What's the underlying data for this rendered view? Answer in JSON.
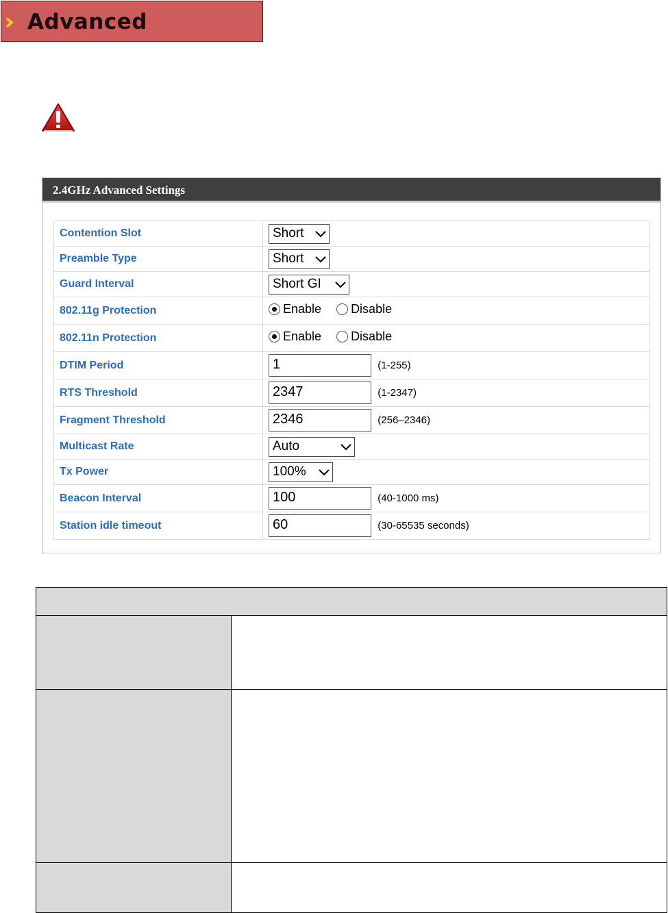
{
  "header": {
    "title": "Advanced"
  },
  "panel": {
    "title": "2.4GHz Advanced Settings",
    "rows": [
      {
        "label": "Contention Slot",
        "kind": "select",
        "value": "Short"
      },
      {
        "label": "Preamble Type",
        "kind": "select",
        "value": "Short"
      },
      {
        "label": "Guard Interval",
        "kind": "select",
        "value": "Short GI"
      },
      {
        "label": "802.11g Protection",
        "kind": "radio",
        "options": [
          "Enable",
          "Disable"
        ],
        "selected": "Enable"
      },
      {
        "label": "802.11n Protection",
        "kind": "radio",
        "options": [
          "Enable",
          "Disable"
        ],
        "selected": "Enable"
      },
      {
        "label": "DTIM Period",
        "kind": "text",
        "value": "1",
        "hint": "(1-255)"
      },
      {
        "label": "RTS Threshold",
        "kind": "text",
        "value": "2347",
        "hint": "(1-2347)"
      },
      {
        "label": "Fragment Threshold",
        "kind": "text",
        "value": "2346",
        "hint": "(256–2346)"
      },
      {
        "label": "Multicast Rate",
        "kind": "select",
        "value": "Auto"
      },
      {
        "label": "Tx Power",
        "kind": "select",
        "value": "100%"
      },
      {
        "label": "Beacon Interval",
        "kind": "text",
        "value": "100",
        "hint": "(40-1000 ms)"
      },
      {
        "label": "Station idle timeout",
        "kind": "text",
        "value": "60",
        "hint": "(30-65535 seconds)"
      }
    ]
  },
  "colors": {
    "banner": "#cf5c5c",
    "panel_header": "#3f3f3f",
    "label_blue": "#2e6db8",
    "warning_red": "#c81e1e"
  },
  "icons": {
    "banner": "chevron-right-icon",
    "warning": "warning-triangle-icon",
    "select": "chevron-down-icon"
  }
}
